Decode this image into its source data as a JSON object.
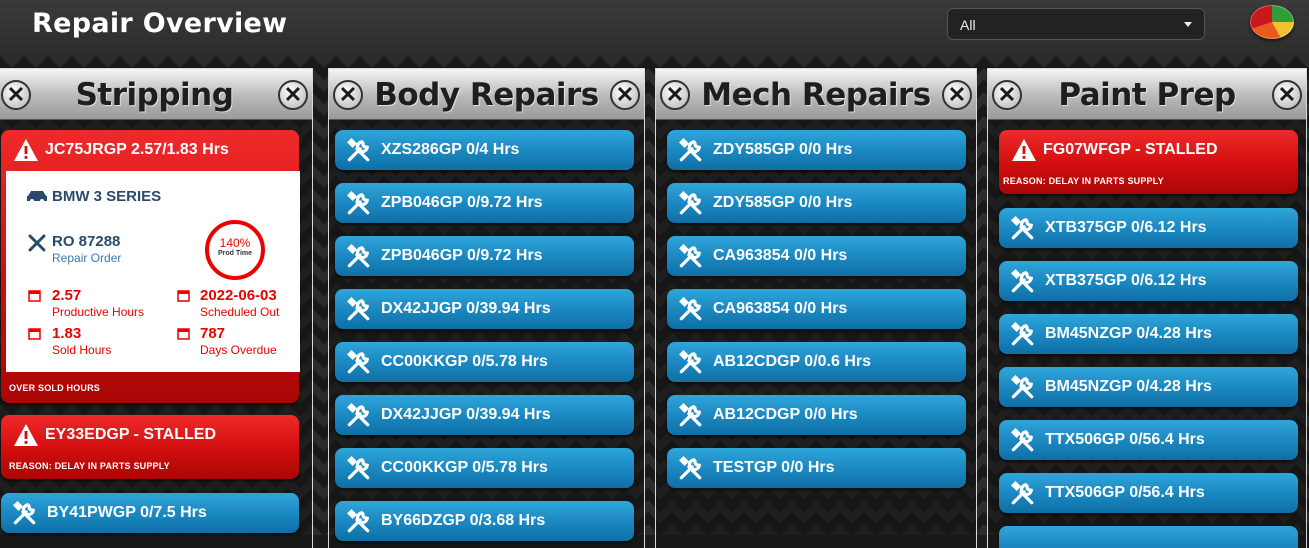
{
  "header": {
    "title": "Repair Overview",
    "filter": {
      "selected": "All"
    }
  },
  "colors": {
    "card_blue": "#1a86bf",
    "card_red": "#d10d0d",
    "text_stat_red": "#e00000",
    "text_label_blue": "#2a4a6a"
  },
  "columns": {
    "stripping": {
      "title": "Stripping",
      "detail_card": {
        "title": "JC75JRGP 2.57/1.83 Hrs",
        "vehicle": "BMW 3 SERIES",
        "repair_order": "RO 87288",
        "repair_order_label": "Repair Order",
        "prod_time_pct": "140%",
        "prod_time_label": "Prod Time",
        "productive_hours": "2.57",
        "productive_hours_label": "Productive Hours",
        "scheduled_out": "2022-06-03",
        "scheduled_out_label": "Scheduled Out",
        "sold_hours": "1.83",
        "sold_hours_label": "Sold Hours",
        "days_overdue": "787",
        "days_overdue_label": "Days Overdue",
        "footer": "OVER SOLD HOURS"
      },
      "stalled_card": {
        "title": "EY33EDGP - STALLED",
        "reason": "REASON: DELAY IN PARTS SUPPLY"
      },
      "items": [
        "BY41PWGP 0/7.5 Hrs"
      ]
    },
    "body": {
      "title": "Body Repairs",
      "items": [
        "XZS286GP 0/4 Hrs",
        "ZPB046GP 0/9.72 Hrs",
        "ZPB046GP 0/9.72 Hrs",
        "DX42JJGP 0/39.94 Hrs",
        "CC00KKGP 0/5.78 Hrs",
        "DX42JJGP 0/39.94 Hrs",
        "CC00KKGP 0/5.78 Hrs",
        "BY66DZGP 0/3.68 Hrs"
      ]
    },
    "mech": {
      "title": "Mech Repairs",
      "items": [
        "ZDY585GP 0/0 Hrs",
        "ZDY585GP 0/0 Hrs",
        "CA963854 0/0 Hrs",
        "CA963854 0/0 Hrs",
        "AB12CDGP 0/0.6 Hrs",
        "AB12CDGP 0/0 Hrs",
        "TESTGP 0/0 Hrs"
      ]
    },
    "paint": {
      "title": "Paint Prep",
      "stalled_card": {
        "title": "FG07WFGP - STALLED",
        "reason": "REASON: DELAY IN PARTS SUPPLY"
      },
      "items": [
        "XTB375GP 0/6.12 Hrs",
        "XTB375GP 0/6.12 Hrs",
        "BM45NZGP 0/4.28 Hrs",
        "BM45NZGP 0/4.28 Hrs",
        "TTX506GP 0/56.4 Hrs",
        "TTX506GP 0/56.4 Hrs"
      ]
    }
  },
  "icons": {
    "wrench": "wrench-icon",
    "alert": "alert-icon",
    "close": "close-icon",
    "car": "car-icon",
    "calendar": "calendar-icon",
    "tools": "tools-icon"
  }
}
